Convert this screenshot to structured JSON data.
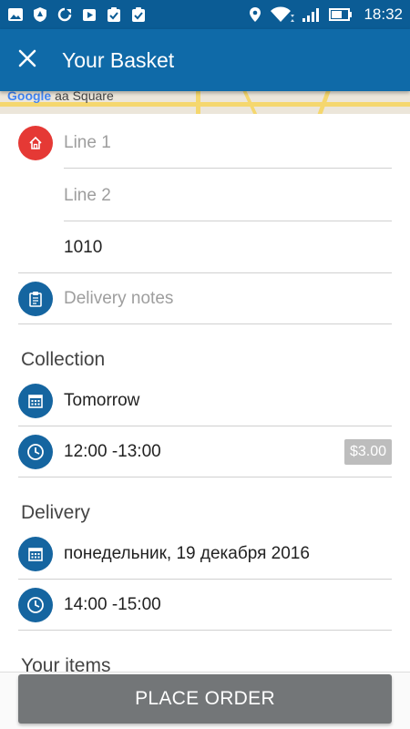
{
  "status_bar": {
    "time": "18:32",
    "icons": [
      "gallery-icon",
      "shield-icon",
      "sync-icon",
      "media-icon",
      "clipboard-check-icon",
      "clipboard-check-icon",
      "location-icon",
      "wifi-icon",
      "signal-icon",
      "battery-icon"
    ]
  },
  "app_bar": {
    "title": "Your Basket",
    "close_icon": "close-icon"
  },
  "map": {
    "logo_text": "Google",
    "place_label": "aa Square"
  },
  "address": {
    "line1_placeholder": "Line 1",
    "line2_placeholder": "Line 2",
    "postcode_value": "1010",
    "notes_placeholder": "Delivery notes"
  },
  "collection": {
    "title": "Collection",
    "date": "Tomorrow",
    "time": "12:00 -13:00",
    "price": "$3.00"
  },
  "delivery": {
    "title": "Delivery",
    "date": "понедельник, 19 декабря 2016",
    "time": "14:00 -15:00"
  },
  "items": {
    "title": "Your items"
  },
  "actions": {
    "place_order": "PLACE ORDER"
  },
  "colors": {
    "status_bar": "#0b5c95",
    "app_bar": "#0f6aa8",
    "icon_blue": "#1565a0",
    "icon_red": "#e53935",
    "button_gray": "#737678"
  }
}
